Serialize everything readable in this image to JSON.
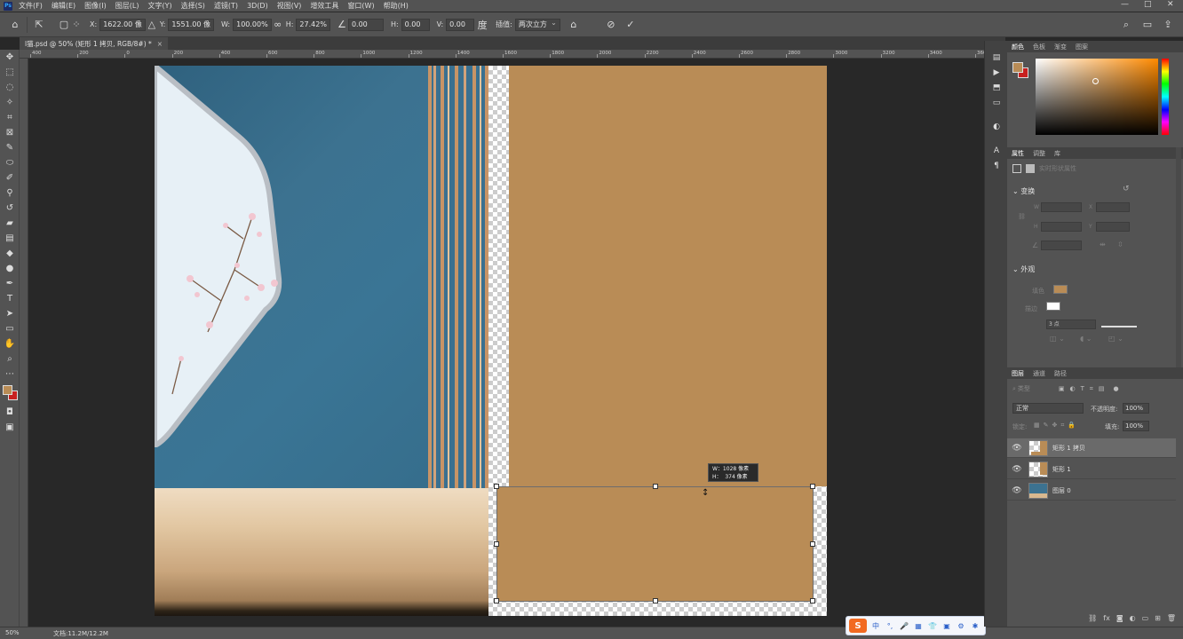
{
  "menubar": {
    "logo": "Ps",
    "items": [
      "文件(F)",
      "编辑(E)",
      "图像(I)",
      "图层(L)",
      "文字(Y)",
      "选择(S)",
      "滤镜(T)",
      "3D(D)",
      "视图(V)",
      "增效工具",
      "窗口(W)",
      "帮助(H)"
    ],
    "win_min": "—",
    "win_max": "□",
    "win_close": "✕"
  },
  "options": {
    "x_label": "X:",
    "x_value": "1622.00 像",
    "y_label": "Y:",
    "y_value": "1551.00 像",
    "w_label": "W:",
    "w_value": "100.00%",
    "h_label": "H:",
    "h_value": "27.42%",
    "angle_value": "0.00",
    "hskew_label": "H:",
    "hskew_value": "0.00",
    "vskew_label": "V:",
    "vskew_value": "0.00",
    "interp_label": "插值:",
    "interp_value": "两次立方",
    "search_icon": "search-icon"
  },
  "document": {
    "tab_title": "l猫.psd @ 50% (矩形 1 拷贝, RGB/8#) *",
    "tab_close": "×",
    "size_tip": "W：1028 像素\nH：  374 像素",
    "fill_color": "#b98c56"
  },
  "ruler": {
    "ticks": [
      "400",
      "200",
      "0",
      "200",
      "400",
      "600",
      "800",
      "1000",
      "1200",
      "1400",
      "1600",
      "1800",
      "2000",
      "2200",
      "2400",
      "2600",
      "2800",
      "3000",
      "3200",
      "3400",
      "3600",
      "3800"
    ]
  },
  "status": {
    "zoom": "50%",
    "doc_info": "文档:11.2M/12.2M"
  },
  "ime": {
    "logo": "S",
    "items": [
      "中",
      "°,",
      "🎤",
      "▦",
      "👕",
      "▣",
      "⚙",
      "✱"
    ]
  },
  "color_panel": {
    "tabs": [
      "颜色",
      "色板",
      "渐变",
      "图案"
    ],
    "foreground": "#b98c56",
    "background": "#c8201f"
  },
  "properties_panel": {
    "tabs": [
      "属性",
      "调整",
      "库"
    ],
    "layer_kind": "实时形状属性",
    "transform_title": "变换",
    "w_lbl": "W",
    "h_lbl": "H",
    "x_lbl": "X",
    "y_lbl": "Y",
    "appearance_title": "外观",
    "fill_label": "填色",
    "stroke_label": "描边",
    "stroke_size": "3 点"
  },
  "layers_panel": {
    "tabs": [
      "图层",
      "通道",
      "路径"
    ],
    "filter_placeholder": "类型",
    "blend_mode": "正常",
    "opacity_label": "不透明度:",
    "opacity_value": "100%",
    "lock_label": "锁定:",
    "fill_label": "填充:",
    "fill_value": "100%",
    "layers": [
      {
        "name": "矩形 1 拷贝",
        "selected": true
      },
      {
        "name": "矩形 1",
        "selected": false
      },
      {
        "name": "图层 0",
        "selected": false
      }
    ]
  }
}
